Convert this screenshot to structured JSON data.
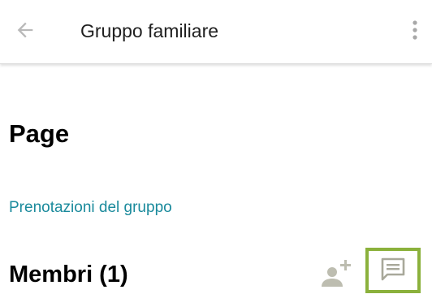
{
  "app_bar": {
    "back_icon": "arrow-left-icon",
    "title": "Gruppo familiare",
    "more_icon": "more-vert-icon"
  },
  "main": {
    "heading": "Page",
    "group_bookings_link": "Prenotazioni del gruppo",
    "members_title": "Membri (1)",
    "add_member_icon": "person-add-icon",
    "chat_icon": "chat-bubble-icon"
  },
  "colors": {
    "link": "#1a8a9c",
    "icon_gray": "#b9b9b9",
    "icon_muted": "#a8a89a",
    "highlight": "#8bb13c"
  }
}
